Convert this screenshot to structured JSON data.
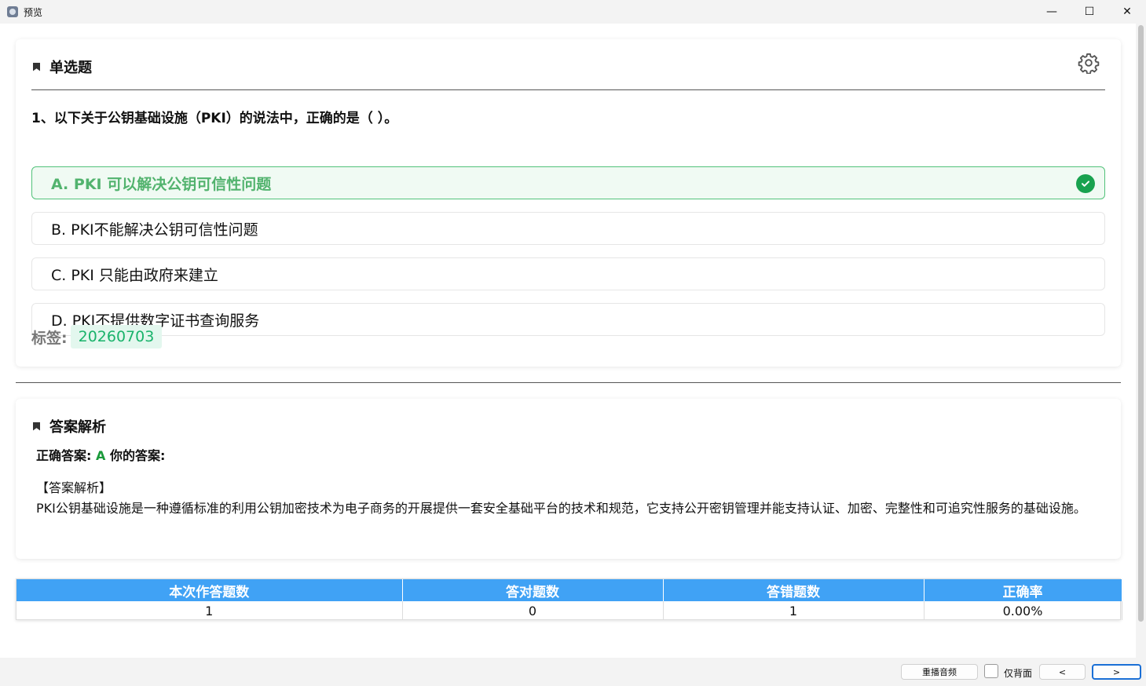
{
  "window": {
    "title": "预览",
    "controls": {
      "minimize": "—",
      "maximize": "☐",
      "close": "✕"
    }
  },
  "question_card": {
    "section_title": "单选题",
    "question": "1、以下关于公钥基础设施（PKI）的说法中，正确的是（ ）。",
    "options": [
      {
        "label": "A. PKI 可以解决公钥可信性问题",
        "correct": true
      },
      {
        "label": "B. PKI不能解决公钥可信性问题",
        "correct": false
      },
      {
        "label": "C. PKI 只能由政府来建立",
        "correct": false
      },
      {
        "label": "D. PKI不提供数字证书查询服务",
        "correct": false
      }
    ],
    "tag_label": "标签:",
    "tag": "20260703"
  },
  "answer_card": {
    "section_title": "答案解析",
    "correct_label": "正确答案:",
    "correct_value": "A",
    "your_label": "你的答案:",
    "your_value": "",
    "analysis_heading": "【答案解析】",
    "analysis_text": "PKI公钥基础设施是一种遵循标准的利用公钥加密技术为电子商务的开展提供一套安全基础平台的技术和规范，它支持公开密钥管理并能支持认证、加密、完整性和可追究性服务的基础设施。"
  },
  "stats": {
    "headers": [
      "本次作答题数",
      "答对题数",
      "答错题数",
      "正确率"
    ],
    "values": [
      "1",
      "0",
      "1",
      "0.00%"
    ]
  },
  "bottom_bar": {
    "replay_audio": "重播音频",
    "back_only": "仅背面",
    "prev": "<",
    "next": ">"
  },
  "colors": {
    "accent_blue": "#40a2f5",
    "correct_green": "#19a24f",
    "tag_green": "#19b36b"
  }
}
